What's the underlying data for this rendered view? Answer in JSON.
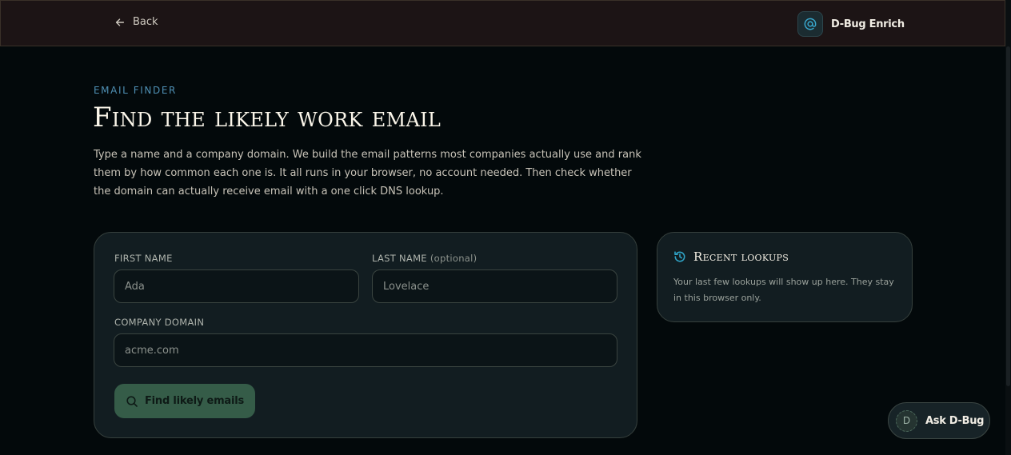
{
  "header": {
    "back_label": "Back",
    "brand_name": "D-Bug Enrich",
    "brand_icon": "at-sign-icon"
  },
  "hero": {
    "eyebrow": "EMAIL FINDER",
    "title": "Find the likely work email",
    "subtitle": "Type a name and a company domain. We build the email patterns most companies actually use and rank them by how common each one is. It all runs in your browser, no account needed. Then check whether the domain can actually receive email with a one click DNS lookup."
  },
  "form": {
    "first_name": {
      "label": "FIRST NAME",
      "placeholder": "Ada",
      "value": ""
    },
    "last_name": {
      "label": "LAST NAME",
      "optional_note": "(optional)",
      "placeholder": "Lovelace",
      "value": ""
    },
    "company_domain": {
      "label": "COMPANY DOMAIN",
      "placeholder": "acme.com",
      "value": ""
    },
    "submit_label": "Find likely emails",
    "submit_icon": "search-icon"
  },
  "recent": {
    "title": "Recent lookups",
    "icon": "history-icon",
    "body": "Your last few lookups will show up here. They stay in this browser only."
  },
  "assistant": {
    "avatar_letter": "D",
    "label": "Ask D-Bug"
  },
  "colors": {
    "background": "#03090b",
    "topbar": "#1c1415",
    "accent_blue": "#4f90b4",
    "button_green": "#355c48",
    "card": "#121d21"
  }
}
